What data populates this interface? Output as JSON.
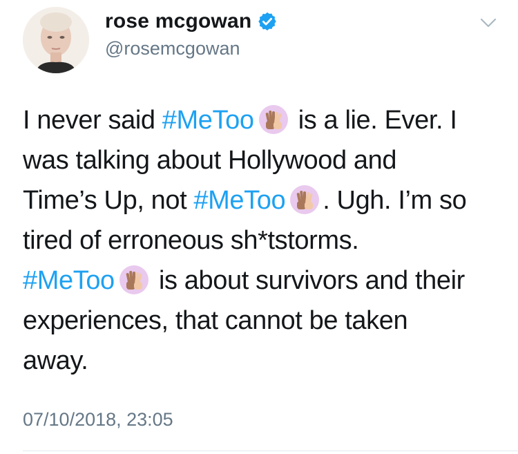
{
  "author": {
    "display_name": "rose mcgowan",
    "handle": "@rosemcgowan",
    "verified": true
  },
  "tweet": {
    "hashtag": "#MeToo",
    "emoji": "raised-hands-icon",
    "line1_a": "I never said ",
    "line1_b": " is a lie. Ever. I",
    "line2": "was talking about Hollywood and",
    "line3_a": "Time’s Up, not ",
    "line3_b": ". Ugh. I’m so",
    "line4": "tired of erroneous sh*tstorms.",
    "line5_b": " is about survivors and their",
    "line6": "experiences, that cannot be taken",
    "line7": "away.",
    "timestamp": "07/10/2018, 23:05"
  },
  "colors": {
    "link": "#1da1f2",
    "secondary_text": "#657786",
    "primary_text": "#14171a",
    "verified_badge": "#1da1f2"
  }
}
